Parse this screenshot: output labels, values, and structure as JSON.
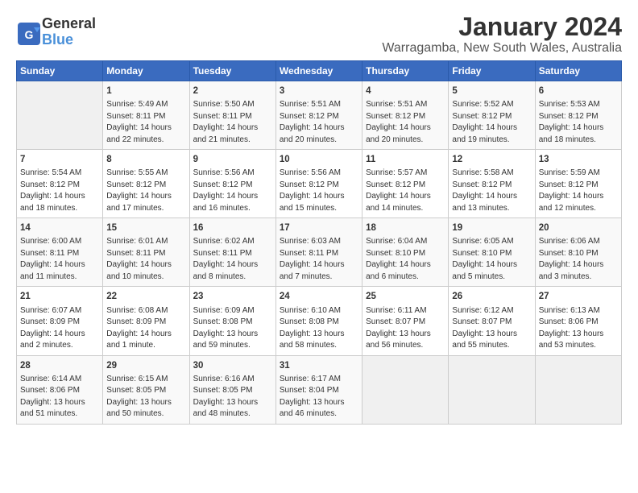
{
  "app": {
    "logo_line1": "General",
    "logo_line2": "Blue"
  },
  "title": "January 2024",
  "subtitle": "Warragamba, New South Wales, Australia",
  "headers": [
    "Sunday",
    "Monday",
    "Tuesday",
    "Wednesday",
    "Thursday",
    "Friday",
    "Saturday"
  ],
  "rows": [
    [
      {
        "day": "",
        "content": ""
      },
      {
        "day": "1",
        "content": "Sunrise: 5:49 AM\nSunset: 8:11 PM\nDaylight: 14 hours\nand 22 minutes."
      },
      {
        "day": "2",
        "content": "Sunrise: 5:50 AM\nSunset: 8:11 PM\nDaylight: 14 hours\nand 21 minutes."
      },
      {
        "day": "3",
        "content": "Sunrise: 5:51 AM\nSunset: 8:12 PM\nDaylight: 14 hours\nand 20 minutes."
      },
      {
        "day": "4",
        "content": "Sunrise: 5:51 AM\nSunset: 8:12 PM\nDaylight: 14 hours\nand 20 minutes."
      },
      {
        "day": "5",
        "content": "Sunrise: 5:52 AM\nSunset: 8:12 PM\nDaylight: 14 hours\nand 19 minutes."
      },
      {
        "day": "6",
        "content": "Sunrise: 5:53 AM\nSunset: 8:12 PM\nDaylight: 14 hours\nand 18 minutes."
      }
    ],
    [
      {
        "day": "7",
        "content": "Sunrise: 5:54 AM\nSunset: 8:12 PM\nDaylight: 14 hours\nand 18 minutes."
      },
      {
        "day": "8",
        "content": "Sunrise: 5:55 AM\nSunset: 8:12 PM\nDaylight: 14 hours\nand 17 minutes."
      },
      {
        "day": "9",
        "content": "Sunrise: 5:56 AM\nSunset: 8:12 PM\nDaylight: 14 hours\nand 16 minutes."
      },
      {
        "day": "10",
        "content": "Sunrise: 5:56 AM\nSunset: 8:12 PM\nDaylight: 14 hours\nand 15 minutes."
      },
      {
        "day": "11",
        "content": "Sunrise: 5:57 AM\nSunset: 8:12 PM\nDaylight: 14 hours\nand 14 minutes."
      },
      {
        "day": "12",
        "content": "Sunrise: 5:58 AM\nSunset: 8:12 PM\nDaylight: 14 hours\nand 13 minutes."
      },
      {
        "day": "13",
        "content": "Sunrise: 5:59 AM\nSunset: 8:12 PM\nDaylight: 14 hours\nand 12 minutes."
      }
    ],
    [
      {
        "day": "14",
        "content": "Sunrise: 6:00 AM\nSunset: 8:11 PM\nDaylight: 14 hours\nand 11 minutes."
      },
      {
        "day": "15",
        "content": "Sunrise: 6:01 AM\nSunset: 8:11 PM\nDaylight: 14 hours\nand 10 minutes."
      },
      {
        "day": "16",
        "content": "Sunrise: 6:02 AM\nSunset: 8:11 PM\nDaylight: 14 hours\nand 8 minutes."
      },
      {
        "day": "17",
        "content": "Sunrise: 6:03 AM\nSunset: 8:11 PM\nDaylight: 14 hours\nand 7 minutes."
      },
      {
        "day": "18",
        "content": "Sunrise: 6:04 AM\nSunset: 8:10 PM\nDaylight: 14 hours\nand 6 minutes."
      },
      {
        "day": "19",
        "content": "Sunrise: 6:05 AM\nSunset: 8:10 PM\nDaylight: 14 hours\nand 5 minutes."
      },
      {
        "day": "20",
        "content": "Sunrise: 6:06 AM\nSunset: 8:10 PM\nDaylight: 14 hours\nand 3 minutes."
      }
    ],
    [
      {
        "day": "21",
        "content": "Sunrise: 6:07 AM\nSunset: 8:09 PM\nDaylight: 14 hours\nand 2 minutes."
      },
      {
        "day": "22",
        "content": "Sunrise: 6:08 AM\nSunset: 8:09 PM\nDaylight: 14 hours\nand 1 minute."
      },
      {
        "day": "23",
        "content": "Sunrise: 6:09 AM\nSunset: 8:08 PM\nDaylight: 13 hours\nand 59 minutes."
      },
      {
        "day": "24",
        "content": "Sunrise: 6:10 AM\nSunset: 8:08 PM\nDaylight: 13 hours\nand 58 minutes."
      },
      {
        "day": "25",
        "content": "Sunrise: 6:11 AM\nSunset: 8:07 PM\nDaylight: 13 hours\nand 56 minutes."
      },
      {
        "day": "26",
        "content": "Sunrise: 6:12 AM\nSunset: 8:07 PM\nDaylight: 13 hours\nand 55 minutes."
      },
      {
        "day": "27",
        "content": "Sunrise: 6:13 AM\nSunset: 8:06 PM\nDaylight: 13 hours\nand 53 minutes."
      }
    ],
    [
      {
        "day": "28",
        "content": "Sunrise: 6:14 AM\nSunset: 8:06 PM\nDaylight: 13 hours\nand 51 minutes."
      },
      {
        "day": "29",
        "content": "Sunrise: 6:15 AM\nSunset: 8:05 PM\nDaylight: 13 hours\nand 50 minutes."
      },
      {
        "day": "30",
        "content": "Sunrise: 6:16 AM\nSunset: 8:05 PM\nDaylight: 13 hours\nand 48 minutes."
      },
      {
        "day": "31",
        "content": "Sunrise: 6:17 AM\nSunset: 8:04 PM\nDaylight: 13 hours\nand 46 minutes."
      },
      {
        "day": "",
        "content": ""
      },
      {
        "day": "",
        "content": ""
      },
      {
        "day": "",
        "content": ""
      }
    ]
  ]
}
